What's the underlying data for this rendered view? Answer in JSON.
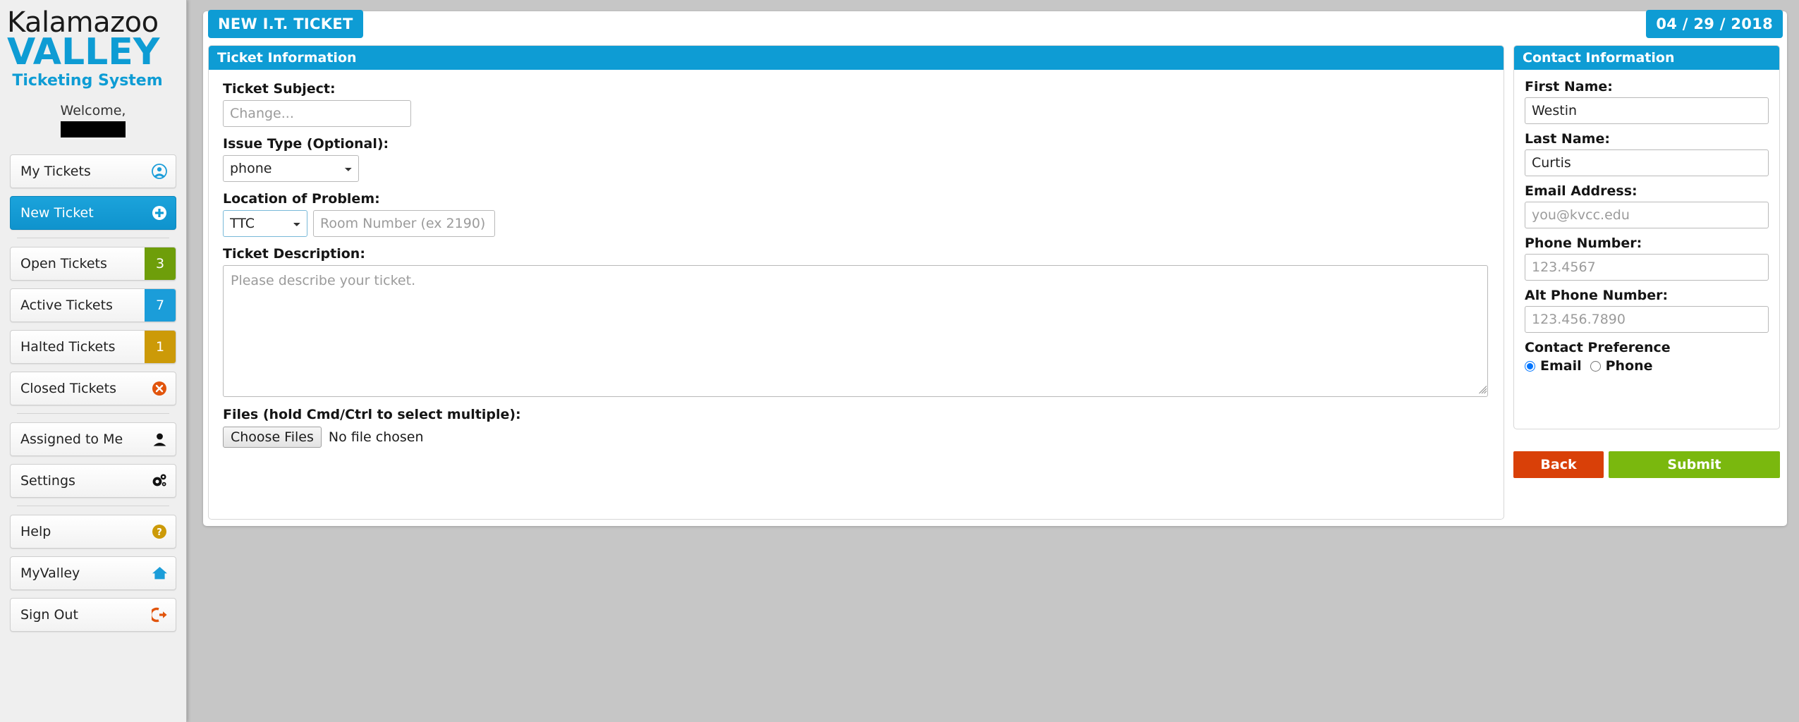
{
  "brand": {
    "line1": "Kalamazoo",
    "line2": "VALLEY",
    "subtitle": "Ticketing System",
    "welcome": "Welcome,",
    "accent_color": "#0e9cd4"
  },
  "sidebar": {
    "items": [
      {
        "label": "My Tickets",
        "icon": "user-circle-icon",
        "badge": null,
        "active": false
      },
      {
        "label": "New Ticket",
        "icon": "plus-circle-icon",
        "badge": null,
        "active": true
      },
      {
        "label": "Open Tickets",
        "icon": null,
        "badge": "3",
        "badge_color": "#6e9e0a",
        "active": false
      },
      {
        "label": "Active Tickets",
        "icon": null,
        "badge": "7",
        "badge_color": "#1b9dd9",
        "active": false
      },
      {
        "label": "Halted Tickets",
        "icon": null,
        "badge": "1",
        "badge_color": "#cc9a08",
        "active": false
      },
      {
        "label": "Closed Tickets",
        "icon": "times-circle-icon",
        "badge": null,
        "active": false
      },
      {
        "label": "Assigned to Me",
        "icon": "user-icon",
        "badge": null,
        "active": false
      },
      {
        "label": "Settings",
        "icon": "gears-icon",
        "badge": null,
        "active": false
      },
      {
        "label": "Help",
        "icon": "question-circle-icon",
        "badge": null,
        "active": false
      },
      {
        "label": "MyValley",
        "icon": "home-icon",
        "badge": null,
        "active": false
      },
      {
        "label": "Sign Out",
        "icon": "sign-out-icon",
        "badge": null,
        "active": false
      }
    ]
  },
  "page": {
    "title": "NEW I.T. TICKET",
    "date": "04 / 29 / 2018"
  },
  "ticket_panel": {
    "heading": "Ticket Information",
    "subject": {
      "label": "Ticket Subject:",
      "value": "",
      "placeholder": "Change..."
    },
    "issue_type": {
      "label": "Issue Type (Optional):",
      "selected": "phone",
      "options": [
        "phone"
      ]
    },
    "location": {
      "label": "Location of Problem:",
      "building_selected": "TTC",
      "building_options": [
        "TTC"
      ],
      "room_value": "",
      "room_placeholder": "Room Number (ex 2190)"
    },
    "description": {
      "label": "Ticket Description:",
      "value": "",
      "placeholder": "Please describe your ticket."
    },
    "files": {
      "label": "Files (hold Cmd/Ctrl to select multiple):",
      "button_label": "Choose Files",
      "status": "No file chosen"
    }
  },
  "contact_panel": {
    "heading": "Contact Information",
    "first_name": {
      "label": "First Name:",
      "value": "Westin",
      "placeholder": ""
    },
    "last_name": {
      "label": "Last Name:",
      "value": "Curtis",
      "placeholder": ""
    },
    "email": {
      "label": "Email Address:",
      "value": "",
      "placeholder": "you@kvcc.edu"
    },
    "phone": {
      "label": "Phone Number:",
      "value": "",
      "placeholder": "123.4567"
    },
    "alt_phone": {
      "label": "Alt Phone Number:",
      "value": "",
      "placeholder": "123.456.7890"
    },
    "preference": {
      "label": "Contact Preference",
      "options": [
        "Email",
        "Phone"
      ],
      "selected": "Email"
    }
  },
  "actions": {
    "back_label": "Back",
    "submit_label": "Submit",
    "back_color": "#d94008",
    "submit_color": "#7ab80e"
  }
}
